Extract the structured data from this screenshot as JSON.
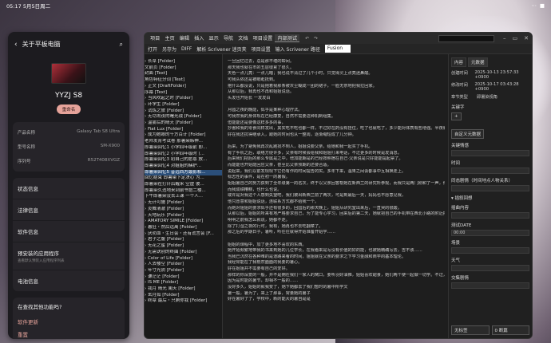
{
  "status": {
    "time": "05:17",
    "date": "5月5日周二",
    "right": "⋯",
    "battery": "■"
  },
  "settings": {
    "title": "关于平板电脑",
    "device_name": "YYZJ S8",
    "rename": "重命名",
    "info": [
      {
        "k": "产品名称",
        "v": "Galaxy Tab S8 Ultra"
      },
      {
        "k": "型号名称",
        "v": "SM-X900"
      },
      {
        "k": "序列号",
        "v": "R52T408XVGZ"
      }
    ],
    "menu1": [
      {
        "label": "状态信息"
      },
      {
        "label": "法律信息"
      },
      {
        "label": "软件信息"
      },
      {
        "label": "预安装的应用程序",
        "sub": "查看默认预装入应用程序列表"
      },
      {
        "label": "电池信息"
      }
    ],
    "help": {
      "title": "在查找其他功能吗?",
      "links": [
        "软件更新",
        "重置"
      ]
    }
  },
  "scrivener": {
    "menu": [
      "项目",
      "主页",
      "编辑",
      "插入",
      "显示",
      "导航",
      "文档",
      "项目设置",
      "内部测试"
    ],
    "active_menu": "内部测试",
    "toolbar": [
      "打开",
      "另存为",
      "DIFF",
      "解析 Scrivener 迷页夹",
      "项目设置",
      "输入 Scrivener 路径"
    ],
    "toolbar_select": "Fusion",
    "binder": [
      "› 长草 [Folder]",
      "文前页 [Folder]",
      "  封面 [Text]",
      "  角色特征分词 [Text]",
      "› 正文 [DraftFolder]",
      "  序幕 [Text]",
      "  › 当风吹起之时 [Folder]",
      "  › 环学生 [Folder]",
      "  › 试炼之旅 [Folder]",
      "  › 无尽闹夜的曙光战 [Folder]",
      "  › 温雾后的晴天 [Folder]",
      "  › Fiat Lux [Folder]",
      "  › 成为她眼的千方百计 [Folder]",
      "    老师发育考试卷 那暑染韩神...",
      "    即暑染回忆1 小学四年级前 即...",
      "    即暑染回忆2 小学四年级时 (...",
      "    即暑染回忆3 初自己的愿恩 放...",
      "    即暑染回忆4 对姐姐的赌护...",
      "    即暑染回忆5 昔远西方最影和...",
      "    回忆结束 即暑染下定决心 为...",
      "    即暑染在打针后醒来 空虚 彼...",
      "    即暑染久违地来到前书馆二楼...",
      "    下午即暑染没去上课 一个人...",
      "  › 无计可施 [Folder]",
      "  › 炎舞清澈 [Folder]",
      "  › 天地玩乐 [Folder]",
      "  › AMATORY SIMILE [Folder]",
      "  › 暮狂・然后远离 [Folder]",
      "  › 厌劝血・生日会・还有谎言会 [F...",
      "  › 君子之腹 [Folder]",
      "  › 无花之蜜 [Folder]",
      "  › 无需诀别的终曲 [Folder]",
      "  › Color of Life [Folder]",
      "  › 人去楼空 [Folder]",
      "  › 年寸光阴 [Folder]",
      "  › 谦茫茫 [Folder]",
      "  › IS ME [Folder]",
      "  › 我月 晴光 阑天 [Folder]",
      "  › 玄月如 [Folder]",
      "  › 终章 最后・只剩你我 [Folder]"
    ],
    "binder_selected": 18,
    "editor": [
      "一旦回忆过去，总是那不堪的瞬间。",
      "那天我也就在市的五层很累了很久。",
      "天色一点儿亮：一点儿暗；我也说不清过了几个小时，只觉得灵上点亮迷鼻酸。",
      "可我头依还是被眼眶抚到。",
      "抱什么都没说，只是抱着我那条被灰尘糊成一团的裙子，一脸无奈地把我拉回家。",
      "从那以后，我再也不再和姐姐说话。",
      "头发也开始长 一发发白",
      "",
      "月圆之夜的晚能，似乎是某种心理疗法。",
      "可我然我的身体现在已经康复，自然不需要这种机制组集。",
      "但能能还是要像这样多多的事，",
      "抄書和我的零食同样发出，其实吃不吃也都一样，不过好在药没有挂住，吃了也就吃了，多少能对体质有些增强。半夜就好的食物其他人又不吃，可不能糟蹋。",
      "好在我还抗得继承入，跟她的时间也从一整周，逐渐缩短成了几分钟。",
      "",
      "后来，为了避免我再次乱跑找不到人，姐姐说要父亲，给她和我一起买了手机。",
      "有了手机之后，联络方便许多，父亲有时候会给我和姐姐打来电话，不过更多的时候是发消息。",
      "后来我们把后的那么专属是之中，增加能期是的已经按照宿在自己·父亲说是只好能能提起票了。",
      "而能能也开始能回应父亲，甚至比父亲预期的还要合适。",
      "说起来，我们以前发现现下它仍有作的时间提告的实。多年下来，温果之间会都事中互相换走上。",
      "标志性的事件，是在初一的暑假。",
      "姐姐暑自己的努力获到了全年级第一的名次，终于以父亲回答帮她在新西兰的研究所参观，而我只是两门刚和了一声，他就决定陪带我上境。",
      "而我成绩糟糕，也什么也说。",
      "或许是对我这个人感到失望吧，我们被出新西兰前了两次，可是到最后一天，妈妈也不愿意见我，",
      "他只愿意和姐姐说话，连联系方式都不给我一个。",
      "而她对姐姐的要求似乎还有很多的，回国后的那天晚上，姐姐从研究室出来后，一直哭的很酸。",
      "从那以后，姐姐的所来有地严格要求自己，为了能专心学习，回来后的第二天，她就把自己的手机带在西北小路的附近把把掉了。",
      "明明之前我怎么就说，她都不走。",
      "除了打湿之夜的行可，我有，她再也不去吃翻菜了。",
      "那之后的学期日子，暑听，听往往就得开始准备开始学……",
      "",
      "姐姐的课程中，加了更多地不喜欢的东西。",
      "她开始频繁地带我的书来到她的几位学长，在我看来是写没有价值的好的能，也被她精确写去，吉不该……",
      "当我已沉然在各种难的是道路来看的时间，姐姐就在父亲的要求之下学习金融和商学的基本理论。",
      "我经常能在了我根然面面的我要的暑心。",
      "好在姐姐并不需要有自己的爱好。",
      "那样的你深爱的一般，并不是拥在我们一家人的窝口，要听羽好油推，姐姐喜欢甜食，她们两个使一起做一切学。不过，姐姐还是这样的。",
      "因为是时能的暑节，却相不一般的……",
      "没好多久，姐姐的就我变了，她下她都去了我们暂时的暑中所学文",
      "暑一般，暑为了，来上了那事，常量她的暑子",
      "好在暑好了了，学校中，新的能大的暑自是是"
    ],
    "inspector": {
      "tabs": [
        "内容",
        "元数据"
      ],
      "active_tab": "元数据",
      "meta": [
        {
          "k": "创建时间",
          "v": "2025-10-13 23:57:33 +0900"
        },
        {
          "k": "修改时间",
          "v": "2025-10-17 03:43:28 +0900"
        },
        {
          "k": "章节类型",
          "v": "即暑染视角"
        }
      ],
      "keyword_label": "关键字",
      "keyword_btn": "+",
      "custom_btn": "自定义元数据",
      "fields": [
        "关键情感",
        "时间",
        "同态剧情（时间地点人物关系）"
      ],
      "divider": "▾ 插叙回想",
      "fields2": [
        "插曲内容"
      ],
      "date_label": "测试DATE",
      "date_value": "00:00",
      "fields3": [
        "场景",
        "天气",
        "交集剧情"
      ],
      "bottom": [
        "无标签",
        "0 断篇"
      ]
    }
  }
}
